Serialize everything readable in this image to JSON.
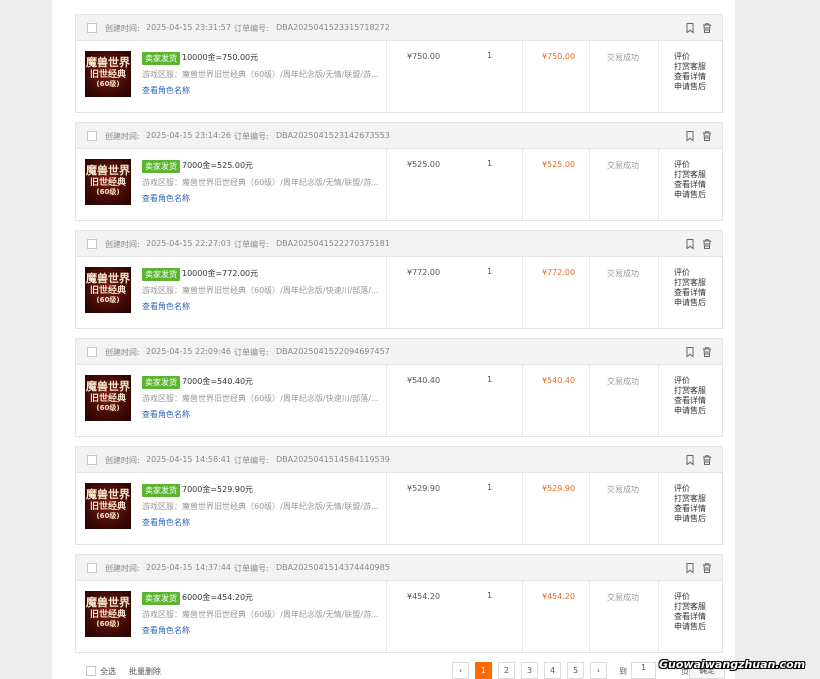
{
  "labels": {
    "created": "创建时间:",
    "order_no": "订单编号:",
    "badge": "卖家发货",
    "view_role": "查看角色名称",
    "act_review": "评价",
    "act_contact": "打赏客服",
    "act_detail": "查看详情",
    "act_aftersale": "申请售后"
  },
  "orders": [
    {
      "time": "2025-04-15 23:31:57",
      "no": "DBA2025041523315718272",
      "title": "10000金=750.00元",
      "desc": "游戏区服：魔兽世界旧世经典（60级）/周年纪念版/无情/联盟/游...",
      "price": "¥750.00",
      "qty": "1",
      "total": "¥750.00",
      "status": "交易成功"
    },
    {
      "time": "2025-04-15 23:14:26",
      "no": "DBA2025041523142673553",
      "title": "7000金=525.00元",
      "desc": "游戏区服：魔兽世界旧世经典（60级）/周年纪念版/无情/联盟/游...",
      "price": "¥525.00",
      "qty": "1",
      "total": "¥525.00",
      "status": "交易成功"
    },
    {
      "time": "2025-04-15 22:27:03",
      "no": "DBA2025041522270375181",
      "title": "10000金=772.00元",
      "desc": "游戏区服：魔兽世界旧世经典（60级）/周年纪念版/快速川/部落/...",
      "price": "¥772.00",
      "qty": "1",
      "total": "¥772.00",
      "status": "交易成功"
    },
    {
      "time": "2025-04-15 22:09:46",
      "no": "DBA2025041522094697457",
      "title": "7000金=540.40元",
      "desc": "游戏区服：魔兽世界旧世经典（60级）/周年纪念版/快速川/部落/...",
      "price": "¥540.40",
      "qty": "1",
      "total": "¥540.40",
      "status": "交易成功"
    },
    {
      "time": "2025-04-15 14:58:41",
      "no": "DBA2025041514584119539",
      "title": "7000金=529.90元",
      "desc": "游戏区服：魔兽世界旧世经典（60级）/周年纪念版/无情/联盟/游...",
      "price": "¥529.90",
      "qty": "1",
      "total": "¥529.90",
      "status": "交易成功"
    },
    {
      "time": "2025-04-15 14:37:44",
      "no": "DBA2025041514374440985",
      "title": "6000金=454.20元",
      "desc": "游戏区服：魔兽世界旧世经典（60级）/周年纪念版/无情/联盟/游...",
      "price": "¥454.20",
      "qty": "1",
      "total": "¥454.20",
      "status": "交易成功"
    }
  ],
  "thumb": {
    "line1": "魔兽世界",
    "line2": "旧世经典",
    "line3": "(60级)"
  },
  "footer": {
    "select_all": "全选",
    "batch_delete": "批量删除"
  },
  "pagination": {
    "prev": "‹",
    "pages": [
      "1",
      "2",
      "3",
      "4",
      "5"
    ],
    "current": "1",
    "next": "›",
    "goto_label": "到",
    "goto_value": "1",
    "page_unit": "页",
    "confirm": "确定"
  },
  "watermark": "Guowaiwangzhuan.com",
  "colors": {
    "accent": "#ff6a00",
    "price_total": "#f06a1c",
    "badge": "#5cb531",
    "link": "#2a65b6"
  }
}
